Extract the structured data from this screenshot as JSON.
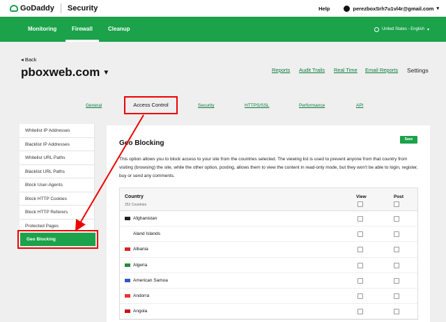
{
  "topbar": {
    "brand": "GoDaddy",
    "section": "Security",
    "help": "Help",
    "user": "perezboxSrh7u1vl4r@gmail.com"
  },
  "nav": {
    "items": [
      "Monitoring",
      "Firewall",
      "Cleanup"
    ],
    "active": "Firewall",
    "locale": "United States - English"
  },
  "header": {
    "back": "Back",
    "site": "pboxweb.com",
    "links": [
      "Reports",
      "Audit Trails",
      "Real Time",
      "Email Reports"
    ],
    "settings": "Settings"
  },
  "tabs": {
    "general": "General",
    "access_control": "Access Control",
    "security": "Security",
    "https": "HTTPS/SSL",
    "performance": "Performance",
    "api": "API"
  },
  "sidebar": {
    "items": [
      "Whitelist IP Addresses",
      "Blacklist IP Addresses",
      "Whitelist URL Paths",
      "Blacklist URL Paths",
      "Block User-Agents",
      "Block HTTP Cookies",
      "Block HTTP Referers",
      "Protected Pages"
    ],
    "active": "Geo Blocking"
  },
  "panel": {
    "title": "Geo Blocking",
    "save": "Save",
    "description": "This option allows you to block access to your site from the countries selected. The viewing list is used to prevent anyone from that country from visiting (browsing) the site, while the other option, posting, allows them to view the content in read-only mode, but they won't be able to login, register, buy or send any comments."
  },
  "table": {
    "col_country": "Country",
    "count": "252 Countries",
    "col_view": "View",
    "col_post": "Post",
    "rows": [
      {
        "name": "Afghanistan",
        "flag": "#222"
      },
      {
        "name": "Aland Islands",
        "flag": ""
      },
      {
        "name": "Albania",
        "flag": "#d22"
      },
      {
        "name": "Algeria",
        "flag": "#2a8a3a"
      },
      {
        "name": "American Samoa",
        "flag": "#35c"
      },
      {
        "name": "Andorra",
        "flag": "#e33"
      },
      {
        "name": "Angola",
        "flag": "#c11"
      }
    ]
  },
  "colors": {
    "brand_green": "#1ba24a",
    "highlight_red": "#e00000"
  }
}
